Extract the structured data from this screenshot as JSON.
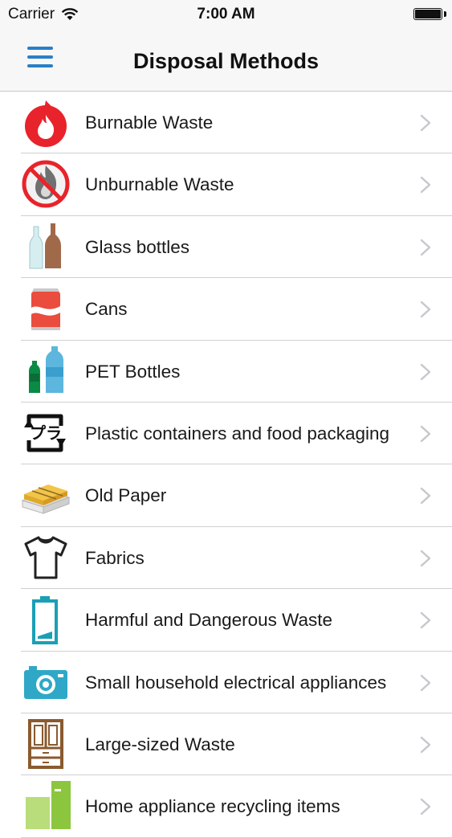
{
  "status": {
    "carrier": "Carrier",
    "time": "7:00 AM"
  },
  "nav": {
    "title": "Disposal Methods",
    "menu_icon": "hamburger-menu-icon"
  },
  "items": [
    {
      "label": "Burnable Waste",
      "icon": "flame-icon"
    },
    {
      "label": "Unburnable Waste",
      "icon": "no-burn-icon"
    },
    {
      "label": "Glass bottles",
      "icon": "glass-bottles-icon"
    },
    {
      "label": "Cans",
      "icon": "can-icon"
    },
    {
      "label": "PET Bottles",
      "icon": "pet-bottles-icon"
    },
    {
      "label": "Plastic containers and food packaging",
      "icon": "plastic-recycle-icon"
    },
    {
      "label": "Old Paper",
      "icon": "paper-bundle-icon"
    },
    {
      "label": "Fabrics",
      "icon": "tshirt-icon"
    },
    {
      "label": "Harmful and Dangerous Waste",
      "icon": "battery-icon"
    },
    {
      "label": "Small household electrical appliances",
      "icon": "camera-icon"
    },
    {
      "label": "Large-sized Waste",
      "icon": "cabinet-icon"
    },
    {
      "label": "Home appliance recycling items",
      "icon": "appliance-icon"
    }
  ],
  "colors": {
    "accent": "#2a7fc7",
    "flame": "#e8232b",
    "teal": "#1a9fb5"
  }
}
